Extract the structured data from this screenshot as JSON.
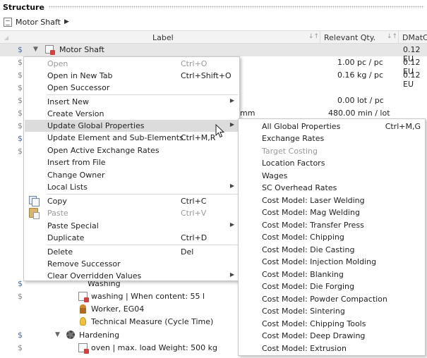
{
  "panel": {
    "title": "Structure"
  },
  "breadcrumb": {
    "item": "Motor Shaft"
  },
  "columns": {
    "label": "Label",
    "relevant_qty": "Relevant Qty.",
    "dmat": "DMatC"
  },
  "rows": [
    {
      "label": "Motor Shaft",
      "qty": "",
      "dmat": "0.12 EU"
    },
    {
      "label": "",
      "qty": "1.00 pc / pc",
      "dmat": "0.12 EU"
    },
    {
      "label": "",
      "qty": "0.16 kg / pc",
      "dmat": "0.12 EU"
    },
    {
      "label": "",
      "qty": "",
      "dmat": ""
    },
    {
      "label": "",
      "qty": "0.00 lot / pc",
      "dmat": ""
    },
    {
      "label": "mm",
      "qty": "480.00 min / lot",
      "dmat": ""
    },
    {
      "label": "Washing",
      "qty": "",
      "dmat": ""
    },
    {
      "label": "washing | When content: 55 l",
      "qty": "",
      "dmat": ""
    },
    {
      "label": "Worker, EG04",
      "qty": "",
      "dmat": ""
    },
    {
      "label": "Technical Measure (Cycle Time)",
      "qty": "",
      "dmat": ""
    },
    {
      "label": "Hardening",
      "qty": "",
      "dmat": ""
    },
    {
      "label": "oven | max. load Weight: 500 kg",
      "qty": "",
      "dmat": ""
    }
  ],
  "context_menu": {
    "items": [
      {
        "label": "Open",
        "shortcut": "Ctrl+O",
        "disabled": true,
        "submenu": false
      },
      {
        "label": "Open in New Tab",
        "shortcut": "Ctrl+Shift+O",
        "disabled": false,
        "submenu": false
      },
      {
        "label": "Open Successor",
        "shortcut": "",
        "disabled": false,
        "submenu": false
      },
      {
        "label": "Insert New",
        "shortcut": "",
        "disabled": false,
        "submenu": true
      },
      {
        "label": "Create Version",
        "shortcut": "",
        "disabled": false,
        "submenu": false
      },
      {
        "label": "Update Global Properties",
        "shortcut": "",
        "disabled": false,
        "submenu": true
      },
      {
        "label": "Update Element and Sub-Elements",
        "shortcut": "Ctrl+M,R",
        "disabled": false,
        "submenu": false
      },
      {
        "label": "Open Active Exchange Rates",
        "shortcut": "",
        "disabled": false,
        "submenu": false
      },
      {
        "label": "Insert from File",
        "shortcut": "",
        "disabled": false,
        "submenu": false
      },
      {
        "label": "Change Owner",
        "shortcut": "",
        "disabled": false,
        "submenu": false
      },
      {
        "label": "Local Lists",
        "shortcut": "",
        "disabled": false,
        "submenu": true
      },
      {
        "label": "Copy",
        "shortcut": "Ctrl+C",
        "disabled": false,
        "submenu": false
      },
      {
        "label": "Paste",
        "shortcut": "Ctrl+V",
        "disabled": true,
        "submenu": false
      },
      {
        "label": "Paste Special",
        "shortcut": "",
        "disabled": false,
        "submenu": true
      },
      {
        "label": "Duplicate",
        "shortcut": "Ctrl+D",
        "disabled": false,
        "submenu": false
      },
      {
        "label": "Delete",
        "shortcut": "Del",
        "disabled": false,
        "submenu": false
      },
      {
        "label": "Remove Successor",
        "shortcut": "",
        "disabled": false,
        "submenu": false
      },
      {
        "label": "Clear Overridden Values",
        "shortcut": "",
        "disabled": false,
        "submenu": true
      }
    ]
  },
  "submenu": {
    "items": [
      {
        "label": "All Global Properties",
        "shortcut": "Ctrl+M,G",
        "disabled": false
      },
      {
        "label": "Exchange Rates",
        "shortcut": "",
        "disabled": false
      },
      {
        "label": "Target Costing",
        "shortcut": "",
        "disabled": true
      },
      {
        "label": "Location Factors",
        "shortcut": "",
        "disabled": false
      },
      {
        "label": "Wages",
        "shortcut": "",
        "disabled": false
      },
      {
        "label": "SC Overhead Rates",
        "shortcut": "",
        "disabled": false
      },
      {
        "label": "Cost Model: Laser Welding",
        "shortcut": "",
        "disabled": false
      },
      {
        "label": "Cost Model: Mag Welding",
        "shortcut": "",
        "disabled": false
      },
      {
        "label": "Cost Model: Transfer Press",
        "shortcut": "",
        "disabled": false
      },
      {
        "label": "Cost Model: Chipping",
        "shortcut": "",
        "disabled": false
      },
      {
        "label": "Cost Model: Die Casting",
        "shortcut": "",
        "disabled": false
      },
      {
        "label": "Cost Model: Injection Molding",
        "shortcut": "",
        "disabled": false
      },
      {
        "label": "Cost Model: Blanking",
        "shortcut": "",
        "disabled": false
      },
      {
        "label": "Cost Model: Die Forging",
        "shortcut": "",
        "disabled": false
      },
      {
        "label": "Cost Model: Powder Compaction",
        "shortcut": "",
        "disabled": false
      },
      {
        "label": "Cost Model: Sintering",
        "shortcut": "",
        "disabled": false
      },
      {
        "label": "Cost Model: Chipping Tools",
        "shortcut": "",
        "disabled": false
      },
      {
        "label": "Cost Model: Deep Drawing",
        "shortcut": "",
        "disabled": false
      },
      {
        "label": "Cost Model: Extrusion",
        "shortcut": "",
        "disabled": false
      }
    ]
  },
  "icons": {
    "breadcrumb": "document-icon",
    "cost": "dollar-icon",
    "copy": "copy-icon",
    "paste": "paste-icon",
    "step": "gear-icon",
    "formula": "formula-icon",
    "worker": "worker-icon",
    "measure": "bulb-icon"
  }
}
